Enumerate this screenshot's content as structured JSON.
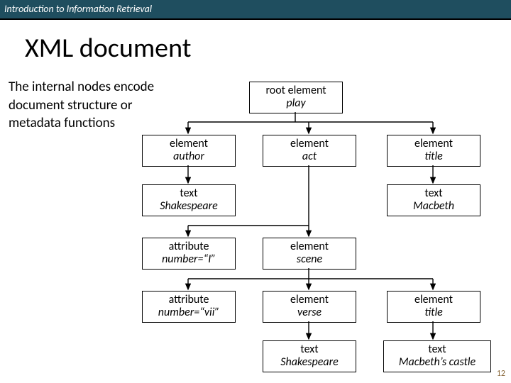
{
  "header": {
    "course": "Introduction to Information Retrieval"
  },
  "title": "XML document",
  "body": "The internal nodes encode document structure or metadata functions",
  "nodes": {
    "root": {
      "l1": "root element",
      "l2": "play"
    },
    "author": {
      "l1": "element",
      "l2": "author"
    },
    "act": {
      "l1": "element",
      "l2": "act"
    },
    "titleTop": {
      "l1": "element",
      "l2": "title"
    },
    "shake1": {
      "l1": "text",
      "l2": "Shakespeare"
    },
    "macbeth": {
      "l1": "text",
      "l2": "Macbeth"
    },
    "attrI": {
      "l1": "attribute",
      "l2": "number=“I”"
    },
    "scene": {
      "l1": "element",
      "l2": "scene"
    },
    "attrVii": {
      "l1": "attribute",
      "l2": "number=“vii”"
    },
    "verse": {
      "l1": "element",
      "l2": "verse"
    },
    "titleBot": {
      "l1": "element",
      "l2": "title"
    },
    "shake2": {
      "l1": "text",
      "l2": "Shakespeare"
    },
    "castle": {
      "l1": "text",
      "l2": "Macbeth’s castle"
    }
  },
  "pagenum": "12"
}
